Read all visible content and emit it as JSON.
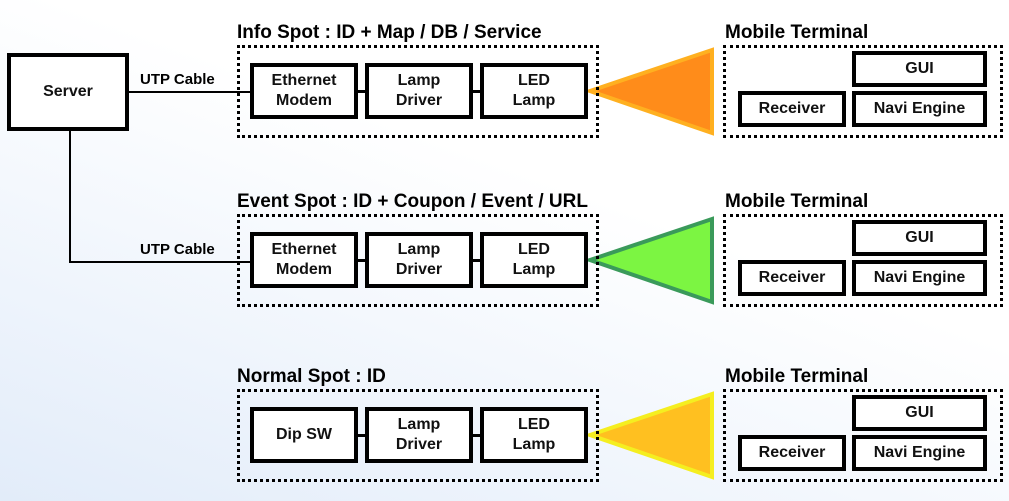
{
  "server": {
    "label": "Server"
  },
  "cable_label": "UTP Cable",
  "spots": [
    {
      "title": "Info Spot : ID + Map / DB / Service",
      "boxes": [
        "Ethernet\nModem",
        "Lamp\nDriver",
        "LED\nLamp"
      ],
      "beam_color": "#ff8c1a",
      "beam_border": "#ffb020"
    },
    {
      "title": "Event Spot : ID + Coupon / Event / URL",
      "boxes": [
        "Ethernet\nModem",
        "Lamp\nDriver",
        "LED\nLamp"
      ],
      "beam_color": "#7cf542",
      "beam_border": "#3a9a5a"
    },
    {
      "title": "Normal Spot : ID",
      "boxes": [
        "Dip SW",
        "Lamp\nDriver",
        "LED\nLamp"
      ],
      "beam_color": "#ffc020",
      "beam_border": "#f5ee20"
    }
  ],
  "terminal": {
    "title": "Mobile Terminal",
    "gui": "GUI",
    "receiver": "Receiver",
    "navi": "Navi Engine"
  }
}
